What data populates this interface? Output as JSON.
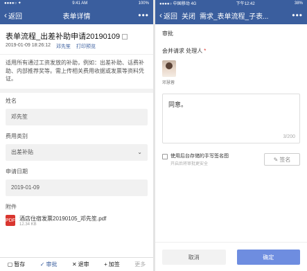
{
  "left": {
    "status": {
      "carrier": "●●●●○ ✦",
      "time": "9:41 AM",
      "battery": "100%"
    },
    "nav": {
      "back": "返回",
      "title": "表单详情",
      "more": "•••"
    },
    "doc": {
      "title": "表单流程_出差补助申请20190109",
      "datetime": "2019-01-09 18:26:12",
      "author": "邓先笙",
      "print": "打印预览",
      "description": "适用所有通过工资发放的补助，例如：出差补助、话费补助、内部推荐奖等。需上传相关费用收据或发票等资料凭证。"
    },
    "fields": [
      {
        "label": "姓名",
        "value": "邓先笙"
      },
      {
        "label": "费用类别",
        "value": "出差补贴"
      },
      {
        "label": "申请日期",
        "value": "2019-01-09"
      }
    ],
    "attachment": {
      "label": "附件",
      "icon": "PDF",
      "name": "酒店住宿发票20190105_邓先笙.pdf",
      "size": "12.34 KB"
    },
    "actions": {
      "save": "暂存",
      "approve": "审批",
      "return": "退审",
      "add_sign": "加签",
      "more": "更多"
    }
  },
  "right": {
    "status": {
      "carrier": "●●●●○ 中国移动 4G",
      "time": "下午12:42",
      "battery": "38%"
    },
    "nav": {
      "back": "返回",
      "close": "关闭",
      "title": "需求_表单流程_子表...",
      "more": "•••"
    },
    "section": "审批",
    "handler_label": "会并请求 处理人",
    "avatar_name": "邓慧蓉",
    "comment": "同意。",
    "counter": "3/200",
    "signature": {
      "text": "使用后台存储的手写签名图",
      "sub": "开启后将审批更安全",
      "button": "签名"
    },
    "footer": {
      "cancel": "取消",
      "ok": "确定"
    }
  }
}
